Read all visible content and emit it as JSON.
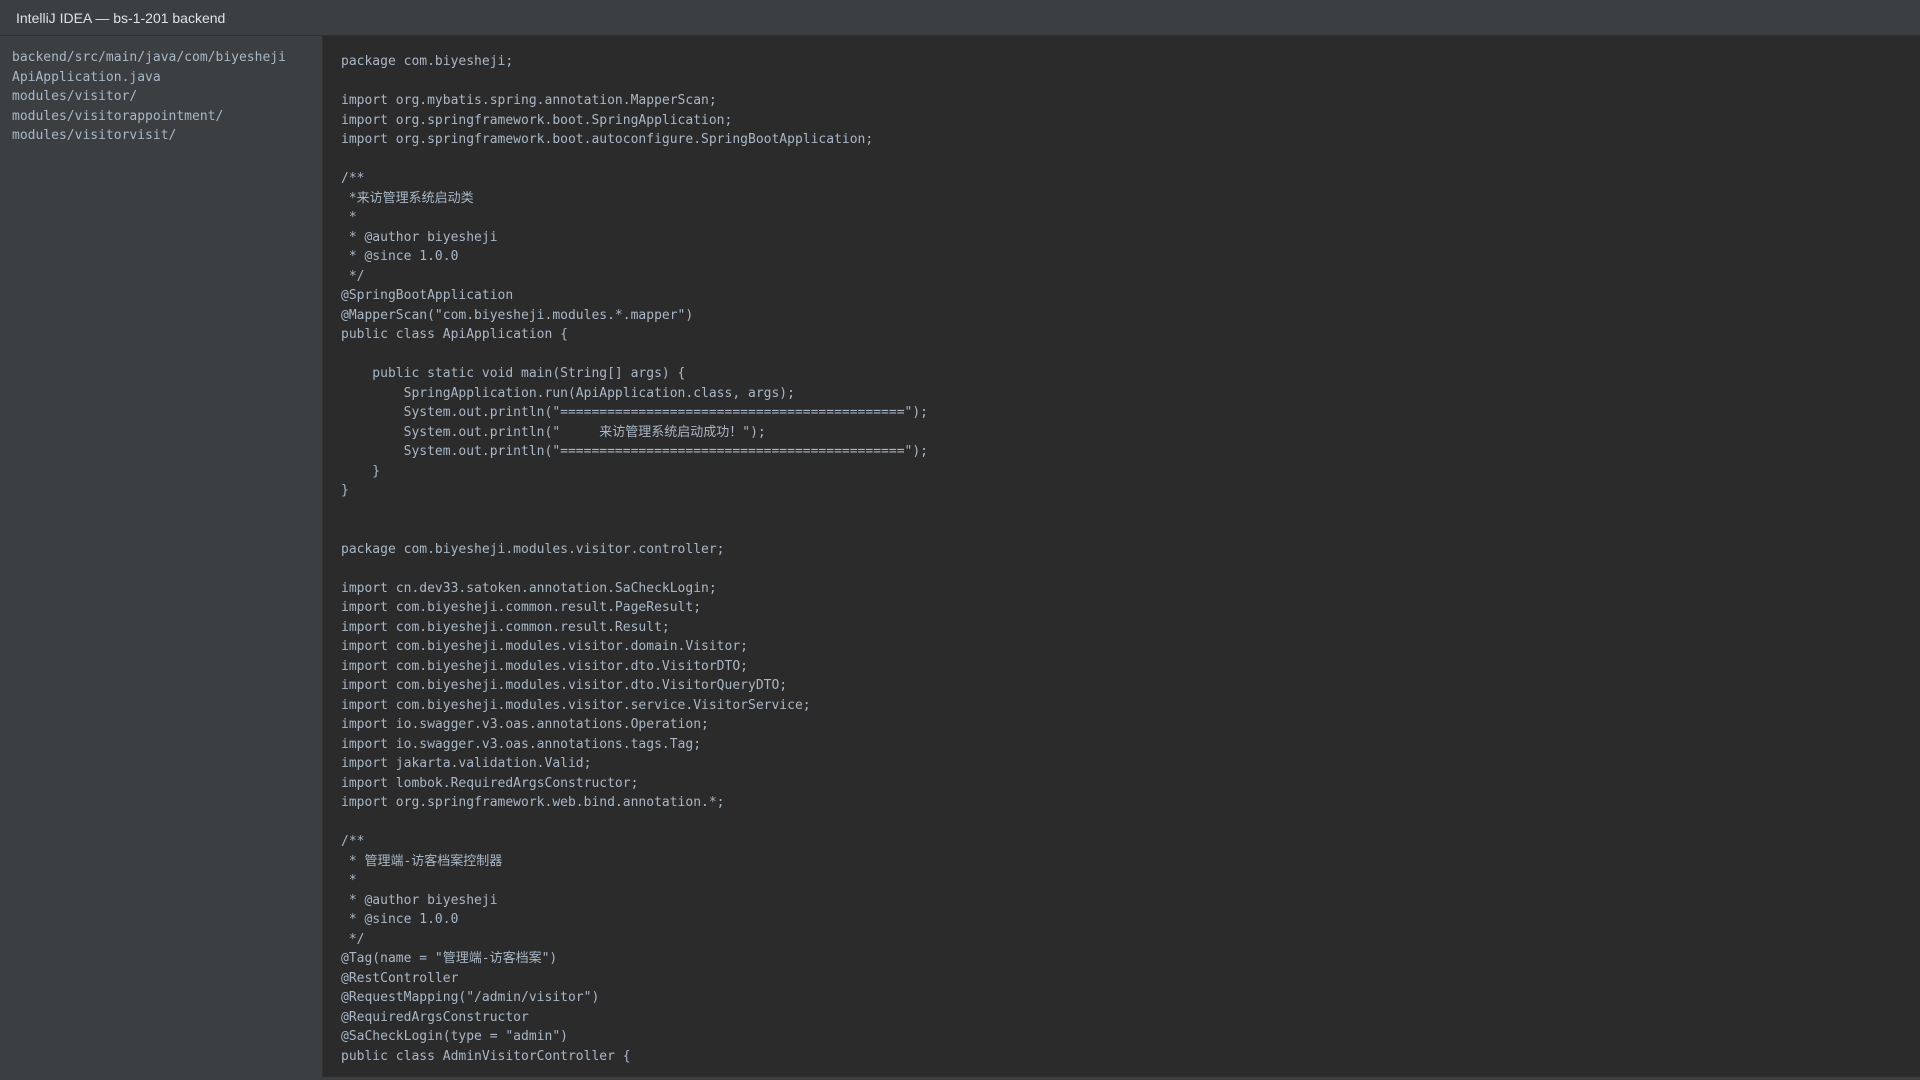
{
  "window": {
    "title": "IntelliJ IDEA — bs-1-201 backend"
  },
  "project_tree": {
    "items": [
      "backend/src/main/java/com/biyesheji",
      "ApiApplication.java",
      "modules/visitor/",
      "modules/visitorappointment/",
      "modules/visitorvisit/"
    ]
  },
  "editor": {
    "lines": [
      "package com.biyesheji;",
      "",
      "import org.mybatis.spring.annotation.MapperScan;",
      "import org.springframework.boot.SpringApplication;",
      "import org.springframework.boot.autoconfigure.SpringBootApplication;",
      "",
      "/**",
      " *来访管理系统启动类",
      " *",
      " * @author biyesheji",
      " * @since 1.0.0",
      " */",
      "@SpringBootApplication",
      "@MapperScan(\"com.biyesheji.modules.*.mapper\")",
      "public class ApiApplication {",
      "",
      "    public static void main(String[] args) {",
      "        SpringApplication.run(ApiApplication.class, args);",
      "        System.out.println(\"============================================\");",
      "        System.out.println(\"     来访管理系统启动成功！\");",
      "        System.out.println(\"============================================\");",
      "    }",
      "}",
      "",
      "",
      "package com.biyesheji.modules.visitor.controller;",
      "",
      "import cn.dev33.satoken.annotation.SaCheckLogin;",
      "import com.biyesheji.common.result.PageResult;",
      "import com.biyesheji.common.result.Result;",
      "import com.biyesheji.modules.visitor.domain.Visitor;",
      "import com.biyesheji.modules.visitor.dto.VisitorDTO;",
      "import com.biyesheji.modules.visitor.dto.VisitorQueryDTO;",
      "import com.biyesheji.modules.visitor.service.VisitorService;",
      "import io.swagger.v3.oas.annotations.Operation;",
      "import io.swagger.v3.oas.annotations.tags.Tag;",
      "import jakarta.validation.Valid;",
      "import lombok.RequiredArgsConstructor;",
      "import org.springframework.web.bind.annotation.*;",
      "",
      "/**",
      " * 管理端-访客档案控制器",
      " *",
      " * @author biyesheji",
      " * @since 1.0.0",
      " */",
      "@Tag(name = \"管理端-访客档案\")",
      "@RestController",
      "@RequestMapping(\"/admin/visitor\")",
      "@RequiredArgsConstructor",
      "@SaCheckLogin(type = \"admin\")",
      "public class AdminVisitorController {"
    ]
  }
}
